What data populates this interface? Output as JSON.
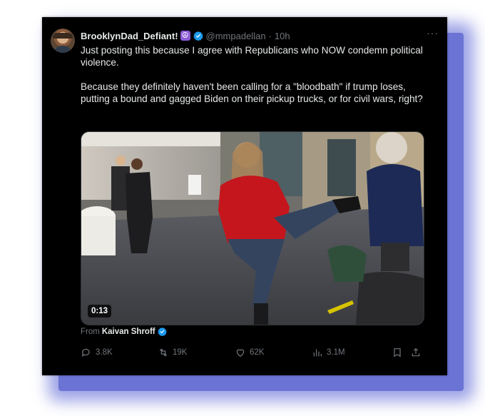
{
  "post": {
    "display_name": "BrooklynDad_Defiant!",
    "name_emoji": "☮",
    "handle": "@mmpadellan",
    "separator": "·",
    "time": "10h",
    "more": "···",
    "text": "Just posting this because I agree with Republicans who NOW condemn political violence.\n\nBecause they definitely haven't been calling for a \"bloodbath\" if trump loses, putting a bound and gagged Biden on their pickup trucks, or for civil wars, right?"
  },
  "media": {
    "duration": "0:13",
    "from_label": "From",
    "from_name": "Kaivan Shroff"
  },
  "actions": {
    "replies": "3.8K",
    "reposts": "19K",
    "likes": "62K",
    "views": "3.1M"
  },
  "colors": {
    "background": "#000000",
    "text": "#e7e9ea",
    "muted": "#71767b",
    "verified": "#1d9bf0",
    "frame_shadow": "#6b74d4"
  },
  "icons": [
    "reply-icon",
    "repost-icon",
    "like-icon",
    "views-icon",
    "bookmark-icon",
    "share-icon",
    "verified-badge-icon",
    "more-icon"
  ]
}
